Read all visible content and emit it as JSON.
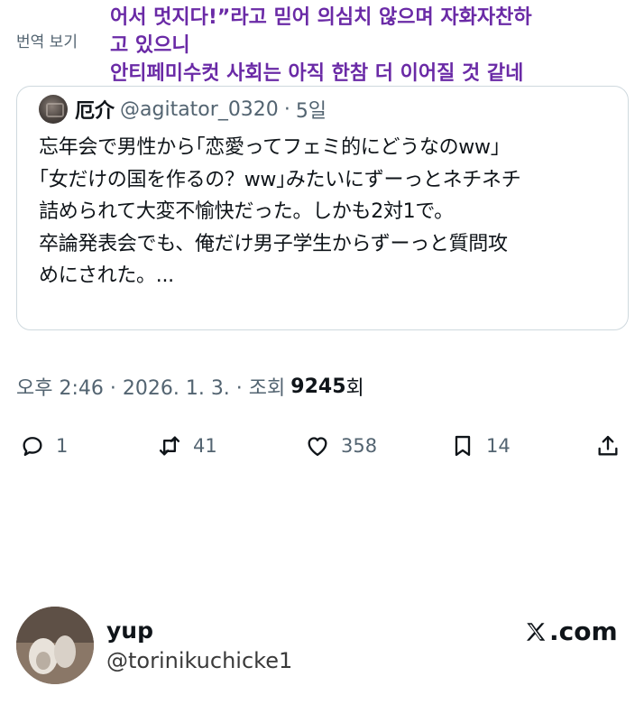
{
  "translate": {
    "link_label": "번역 보기",
    "lines": [
      "어서 멋지다!”라고 믿어 의심치 않으며 자화자찬하",
      "고 있으니",
      "안티페미수컷 사회는 아직 한참 더 이어질 것 같네"
    ]
  },
  "quote": {
    "name": "厄介",
    "handle": "@agitator_0320",
    "separator": "·",
    "time": "5일",
    "lines": [
      "忘年会で男性から｢恋愛ってフェミ的にどうなのww｣",
      "｢女だけの国を作るの？ww｣みたいにずーっとネチネチ",
      "詰められて大変不愉快だった。しかも2対1で。",
      "卒論発表会でも、俺だけ男子学生からずーっと質問攻",
      "めにされた。..."
    ]
  },
  "meta": {
    "timestamp": "오후 2:46 · 2026. 1. 3. · 조회",
    "views_count": "9245",
    "views_label": "회"
  },
  "actions": {
    "reply_icon": "reply-bubble-icon",
    "reply_count": "1",
    "repost_icon": "repost-arrows-icon",
    "repost_count": "41",
    "like_icon": "heart-icon",
    "like_count": "358",
    "bookmark_icon": "bookmark-icon",
    "bookmark_count": "14",
    "share_icon": "share-upload-icon"
  },
  "footer": {
    "name": "yup",
    "handle": "@torinikuchicke1",
    "brand": ".com",
    "brand_icon": "x-logo-icon"
  }
}
